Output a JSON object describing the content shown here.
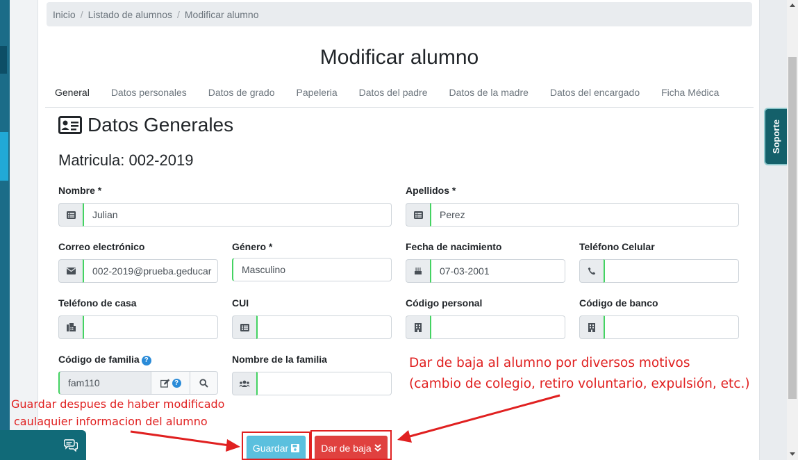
{
  "breadcrumb": [
    "Inicio",
    "Listado de alumnos",
    "Modificar alumno"
  ],
  "page_title": "Modificar alumno",
  "tabs": [
    {
      "label": "General",
      "active": true
    },
    {
      "label": "Datos personales"
    },
    {
      "label": "Datos de grado"
    },
    {
      "label": "Papeleria"
    },
    {
      "label": "Datos del padre"
    },
    {
      "label": "Datos de la madre"
    },
    {
      "label": "Datos del encargado"
    },
    {
      "label": "Ficha Médica"
    }
  ],
  "section": {
    "title": "Datos Generales",
    "icon": "id-card-icon"
  },
  "matricula": "Matricula: 002-2019",
  "fields": {
    "nombre": {
      "label": "Nombre *",
      "value": "Julian"
    },
    "apellidos": {
      "label": "Apellidos *",
      "value": "Perez"
    },
    "correo": {
      "label": "Correo electrónico",
      "value": "002-2019@prueba.geducar"
    },
    "genero": {
      "label": "Género *",
      "value": "Masculino"
    },
    "fecha_nacimiento": {
      "label": "Fecha de nacimiento",
      "value": "07-03-2001"
    },
    "telefono_celular": {
      "label": "Teléfono Celular",
      "value": ""
    },
    "telefono_casa": {
      "label": "Teléfono de casa",
      "value": ""
    },
    "cui": {
      "label": "CUI",
      "value": ""
    },
    "codigo_personal": {
      "label": "Código personal",
      "value": ""
    },
    "codigo_banco": {
      "label": "Código de banco",
      "value": ""
    },
    "codigo_familia": {
      "label": "Código de familia",
      "value": "fam110"
    },
    "nombre_familia": {
      "label": "Nombre de la familia",
      "value": ""
    }
  },
  "buttons": {
    "save": "Guardar",
    "baja": "Dar de baja"
  },
  "annotations": {
    "save_note_1": "Guardar despues de haber modificado",
    "save_note_2": "caulaquier informacion del alumno",
    "baja_note_1": "Dar de baja al alumno por diversos motivos",
    "baja_note_2": "(cambio de colegio, retiro voluntario, expulsión, etc.)"
  },
  "soporte": "Soporte",
  "colors": {
    "annotation_red": "#e02020",
    "save_button": "#5bc0de",
    "baja_button": "#e0413f",
    "input_focus_green": "#44d362",
    "support_tab": "#14606a"
  }
}
